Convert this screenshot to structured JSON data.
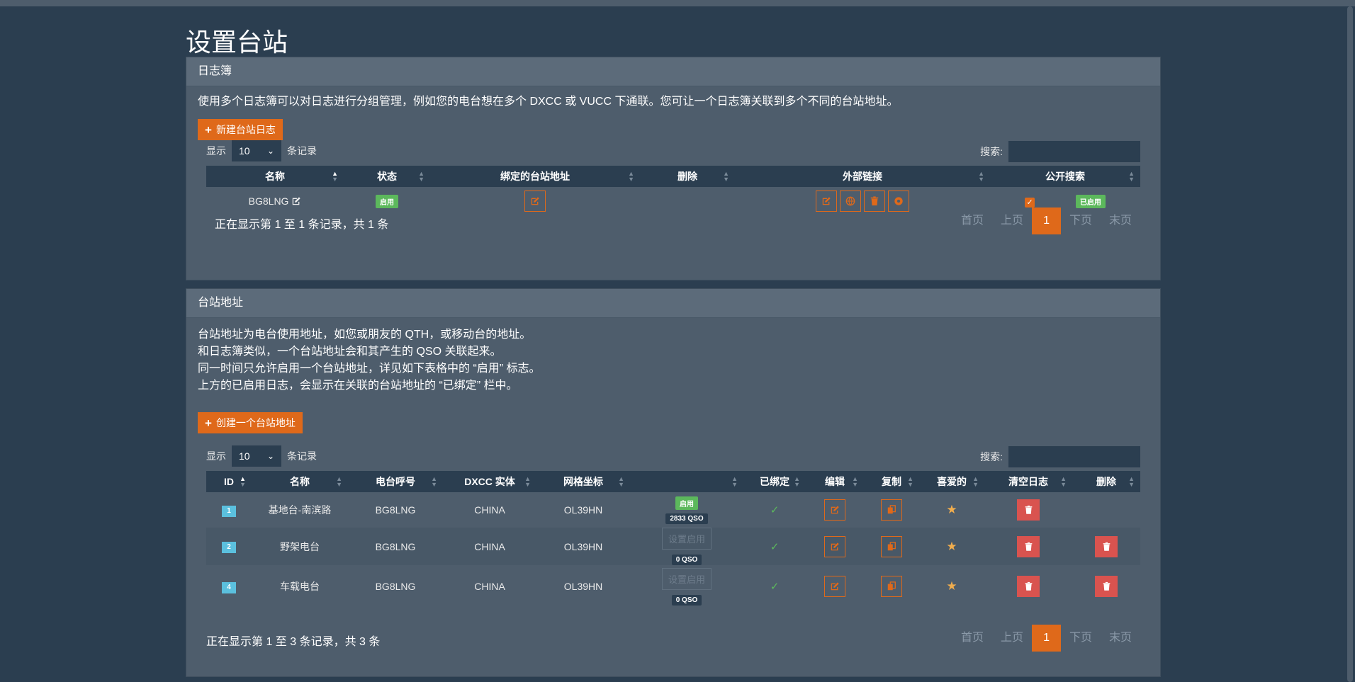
{
  "page": {
    "title": "设置台站"
  },
  "colors": {
    "bg": "#2b3e50",
    "panel": "#4e5d6c",
    "accent": "#df691a",
    "success": "#5cb85c",
    "danger": "#d9534f",
    "info": "#5bc0de",
    "star": "#f0ad4e"
  },
  "logbooks": {
    "header": "日志簿",
    "description": "使用多个日志簿可以对日志进行分组管理，例如您的电台想在多个 DXCC 或 VUCC 下通联。您可让一个日志簿关联到多个不同的台站地址。",
    "new_button": "新建台站日志",
    "length": {
      "prefix": "显示",
      "value": "10",
      "suffix": "条记录"
    },
    "search_label": "搜索:",
    "columns": [
      "名称",
      "状态",
      "绑定的台站地址",
      "删除",
      "外部链接",
      "公开搜索"
    ],
    "rows": [
      {
        "name": "BG8LNG",
        "status": "启用",
        "public_search": "已启用",
        "icons": [
          "edit-icon",
          "globe-icon",
          "trash-icon",
          "share-icon"
        ]
      }
    ],
    "info": "正在显示第 1 至 1 条记录，共 1 条",
    "pagination": {
      "first": "首页",
      "prev": "上页",
      "current": "1",
      "next": "下页",
      "last": "末页"
    }
  },
  "locations": {
    "header": "台站地址",
    "description": [
      "台站地址为电台使用地址，如您或朋友的 QTH，或移动台的地址。",
      "和日志簿类似，一个台站地址会和其产生的 QSO 关联起来。",
      "同一时间只允许启用一个台站地址，详见如下表格中的 “启用” 标志。",
      "上方的已启用日志，会显示在关联的台站地址的 “已绑定” 栏中。"
    ],
    "new_button": "创建一个台站地址",
    "length": {
      "prefix": "显示",
      "value": "10",
      "suffix": "条记录"
    },
    "search_label": "搜索:",
    "columns": [
      "ID",
      "名称",
      "电台呼号",
      "DXCC 实体",
      "网格坐标",
      "",
      "已绑定",
      "编辑",
      "复制",
      "喜爱的",
      "清空日志",
      "删除"
    ],
    "rows": [
      {
        "id": "1",
        "name": "基地台-南滨路",
        "callsign": "BG8LNG",
        "dxcc": "CHINA",
        "grid": "OL39HN",
        "active_badge": "启用",
        "qso": "2833 QSO",
        "set_active": "",
        "deletable": false
      },
      {
        "id": "2",
        "name": "野架电台",
        "callsign": "BG8LNG",
        "dxcc": "CHINA",
        "grid": "OL39HN",
        "active_badge": "",
        "qso": "0 QSO",
        "set_active": "设置启用",
        "deletable": true
      },
      {
        "id": "4",
        "name": "车载电台",
        "callsign": "BG8LNG",
        "dxcc": "CHINA",
        "grid": "OL39HN",
        "active_badge": "",
        "qso": "0 QSO",
        "set_active": "设置启用",
        "deletable": true
      }
    ],
    "info": "正在显示第 1 至 3 条记录，共 3 条",
    "pagination": {
      "first": "首页",
      "prev": "上页",
      "current": "1",
      "next": "下页",
      "last": "末页"
    }
  }
}
